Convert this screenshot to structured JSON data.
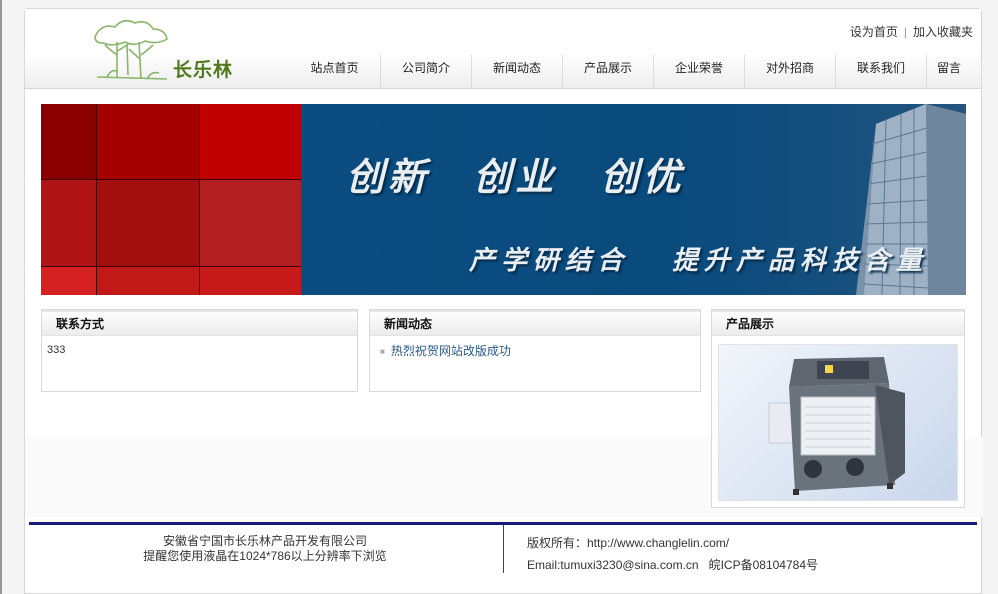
{
  "header": {
    "logo_text": "长乐林",
    "logo_icon": "tree-icon",
    "toplinks": {
      "set_home": "设为首页",
      "add_favorite": "加入收藏夹",
      "separator": "|"
    }
  },
  "nav": {
    "items": [
      {
        "label": "站点首页"
      },
      {
        "label": "公司简介"
      },
      {
        "label": "新闻动态"
      },
      {
        "label": "产品展示"
      },
      {
        "label": "企业荣誉"
      },
      {
        "label": "对外招商"
      },
      {
        "label": "联系我们"
      },
      {
        "label": "留言"
      }
    ]
  },
  "banner": {
    "slogan1": "创新 创业 创优",
    "slogan2": "产学研结合 提升产品科技含量"
  },
  "contact_box": {
    "title": "联系方式",
    "content": "333"
  },
  "news_box": {
    "title": "新闻动态",
    "items": [
      "热烈祝贺网站改版成功"
    ]
  },
  "product_box": {
    "title": "产品展示"
  },
  "footer": {
    "company": "安徽省宁国市长乐林产品开发有限公司",
    "resolution_tip": "提醒您使用液晶在1024*786以上分辨率下浏览",
    "copyright": "版权所有：http://www.changlelin.com/",
    "email": "Email:tumuxi3230@sina.com.cn",
    "icp": "皖ICP备08104784号"
  }
}
